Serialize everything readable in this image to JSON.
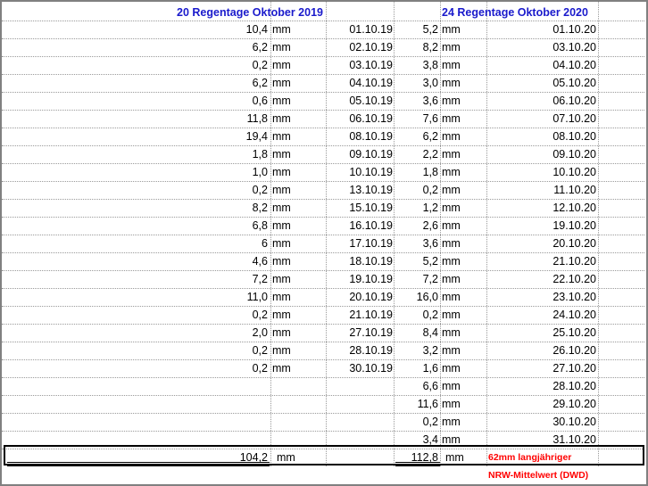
{
  "header_2019": "20 Regentage Oktober 2019",
  "header_2020": "24 Regentage Oktober 2020",
  "unit": "mm",
  "rows_2019": [
    {
      "value": "10,4",
      "date": "01.10.19"
    },
    {
      "value": "6,2",
      "date": "02.10.19"
    },
    {
      "value": "0,2",
      "date": "03.10.19"
    },
    {
      "value": "6,2",
      "date": "04.10.19"
    },
    {
      "value": "0,6",
      "date": "05.10.19"
    },
    {
      "value": "11,8",
      "date": "06.10.19"
    },
    {
      "value": "19,4",
      "date": "08.10.19"
    },
    {
      "value": "1,8",
      "date": "09.10.19"
    },
    {
      "value": "1,0",
      "date": "10.10.19"
    },
    {
      "value": "0,2",
      "date": "13.10.19"
    },
    {
      "value": "8,2",
      "date": "15.10.19"
    },
    {
      "value": "6,8",
      "date": "16.10.19"
    },
    {
      "value": "6",
      "date": "17.10.19"
    },
    {
      "value": "4,6",
      "date": "18.10.19"
    },
    {
      "value": "7,2",
      "date": "19.10.19"
    },
    {
      "value": "11,0",
      "date": "20.10.19"
    },
    {
      "value": "0,2",
      "date": "21.10.19"
    },
    {
      "value": "2,0",
      "date": "27.10.19"
    },
    {
      "value": "0,2",
      "date": "28.10.19"
    },
    {
      "value": "0,2",
      "date": "30.10.19"
    }
  ],
  "rows_2020": [
    {
      "value": "5,2",
      "date": "01.10.20"
    },
    {
      "value": "8,2",
      "date": "03.10.20"
    },
    {
      "value": "3,8",
      "date": "04.10.20"
    },
    {
      "value": "3,0",
      "date": "05.10.20"
    },
    {
      "value": "3,6",
      "date": "06.10.20"
    },
    {
      "value": "7,6",
      "date": "07.10.20"
    },
    {
      "value": "6,2",
      "date": "08.10.20"
    },
    {
      "value": "2,2",
      "date": "09.10.20"
    },
    {
      "value": "1,8",
      "date": "10.10.20"
    },
    {
      "value": "0,2",
      "date": "11.10.20"
    },
    {
      "value": "1,2",
      "date": "12.10.20"
    },
    {
      "value": "2,6",
      "date": "19.10.20"
    },
    {
      "value": "3,6",
      "date": "20.10.20"
    },
    {
      "value": "5,2",
      "date": "21.10.20"
    },
    {
      "value": "7,2",
      "date": "22.10.20"
    },
    {
      "value": "16,0",
      "date": "23.10.20"
    },
    {
      "value": "0,2",
      "date": "24.10.20"
    },
    {
      "value": "8,4",
      "date": "25.10.20"
    },
    {
      "value": "3,2",
      "date": "26.10.20"
    },
    {
      "value": "1,6",
      "date": "27.10.20"
    },
    {
      "value": "6,6",
      "date": "28.10.20"
    },
    {
      "value": "11,6",
      "date": "29.10.20"
    },
    {
      "value": "0,2",
      "date": "30.10.20"
    },
    {
      "value": "3,4",
      "date": "31.10.20"
    }
  ],
  "total_2019": "104,2",
  "total_2020": "112,8",
  "note_line1": "62mm langjähriger",
  "note_line2": "NRW-Mittelwert (DWD)",
  "colors": {
    "header": "#1a1acc",
    "note": "#ff0000",
    "grid": "#9a9a9a",
    "frame": "#808080"
  }
}
